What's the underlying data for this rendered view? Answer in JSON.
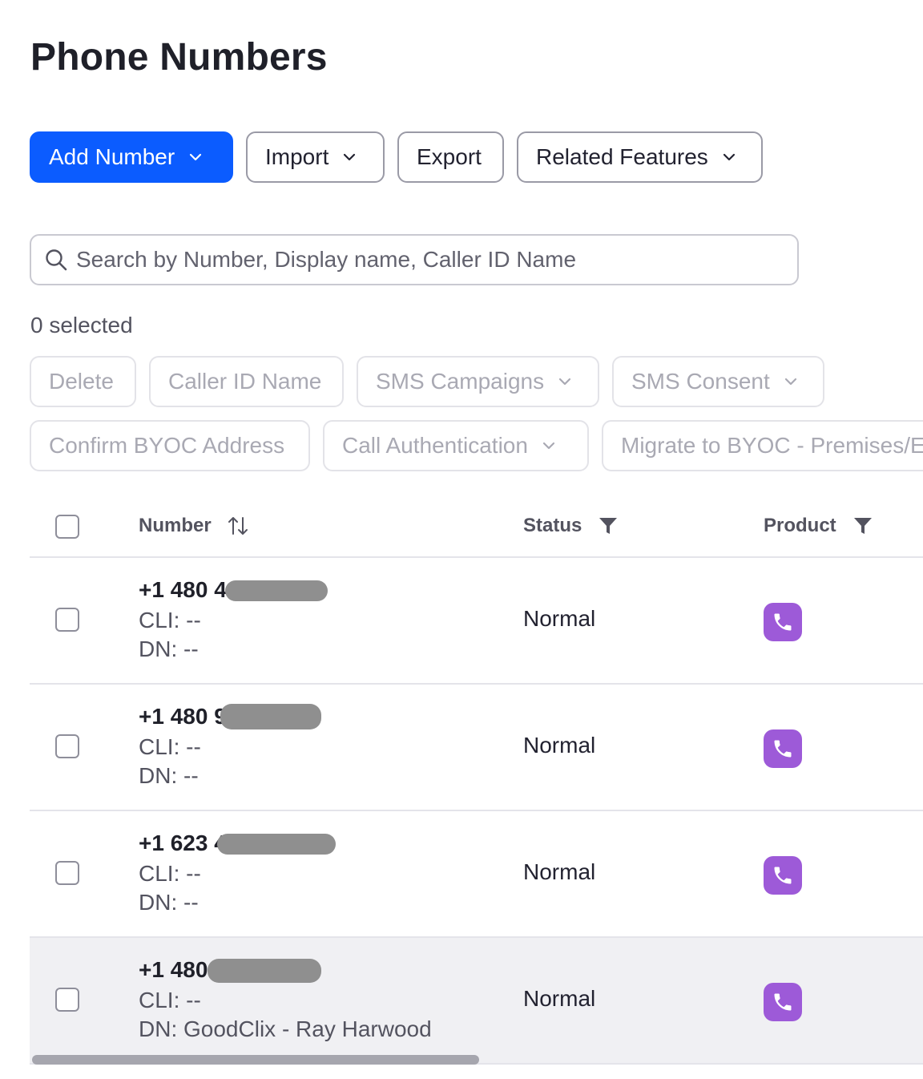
{
  "page": {
    "title": "Phone Numbers"
  },
  "toolbar": {
    "add_number": "Add Number",
    "import": "Import",
    "export": "Export",
    "related_features": "Related Features"
  },
  "search": {
    "placeholder": "Search by Number, Display name, Caller ID Name",
    "value": ""
  },
  "selection": {
    "count_label": "0 selected"
  },
  "bulk_actions": {
    "delete": "Delete",
    "caller_id_name": "Caller ID Name",
    "sms_campaigns": "SMS Campaigns",
    "sms_consent": "SMS Consent",
    "confirm_byoc": "Confirm BYOC Address",
    "call_authentication": "Call Authentication",
    "migrate_byoc": "Migrate to BYOC - Premises/E"
  },
  "table": {
    "columns": {
      "number": "Number",
      "status": "Status",
      "product": "Product"
    },
    "rows": [
      {
        "number": "+1 480 4",
        "cli": "CLI: --",
        "dn": "DN: --",
        "status": "Normal",
        "product_icon": "phone-icon"
      },
      {
        "number": "+1 480 9",
        "cli": "CLI: --",
        "dn": "DN: --",
        "status": "Normal",
        "product_icon": "phone-icon"
      },
      {
        "number": "+1 623 4",
        "cli": "CLI: --",
        "dn": "DN: --",
        "status": "Normal",
        "product_icon": "phone-icon"
      },
      {
        "number": "+1 480",
        "cli": "CLI: --",
        "dn": "DN: GoodClix - Ray Harwood",
        "status": "Normal",
        "product_icon": "phone-icon"
      }
    ]
  },
  "colors": {
    "primary": "#0b5cff",
    "product_badge": "#9d5ad8",
    "highlight_row": "#f0f0f3"
  }
}
